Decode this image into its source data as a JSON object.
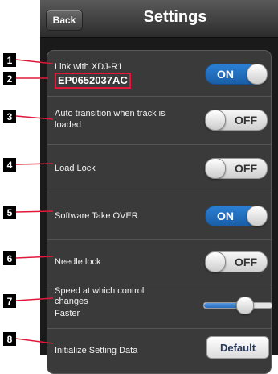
{
  "nav": {
    "back_label": "Back",
    "title": "Settings"
  },
  "settings": [
    {
      "label": "Link with XDJ-R1",
      "sub": "EP0652037AC",
      "toggle": "ON"
    },
    {
      "label": "Auto transition when track is loaded",
      "toggle": "OFF"
    },
    {
      "label": "Load Lock",
      "toggle": "OFF"
    },
    {
      "label": "Software Take OVER",
      "toggle": "ON"
    },
    {
      "label": "Needle lock",
      "toggle": "OFF"
    },
    {
      "label1": "Speed at which control changes",
      "label2": "Faster",
      "slider_value": 0.62
    },
    {
      "label": "Initialize Setting Data",
      "button": "Default"
    }
  ],
  "callouts": [
    "1",
    "2",
    "3",
    "4",
    "5",
    "6",
    "7",
    "8"
  ],
  "colors": {
    "accent_on": "#1f6ec0",
    "callout_line": "#e0183a",
    "callout_box": "#000000"
  }
}
